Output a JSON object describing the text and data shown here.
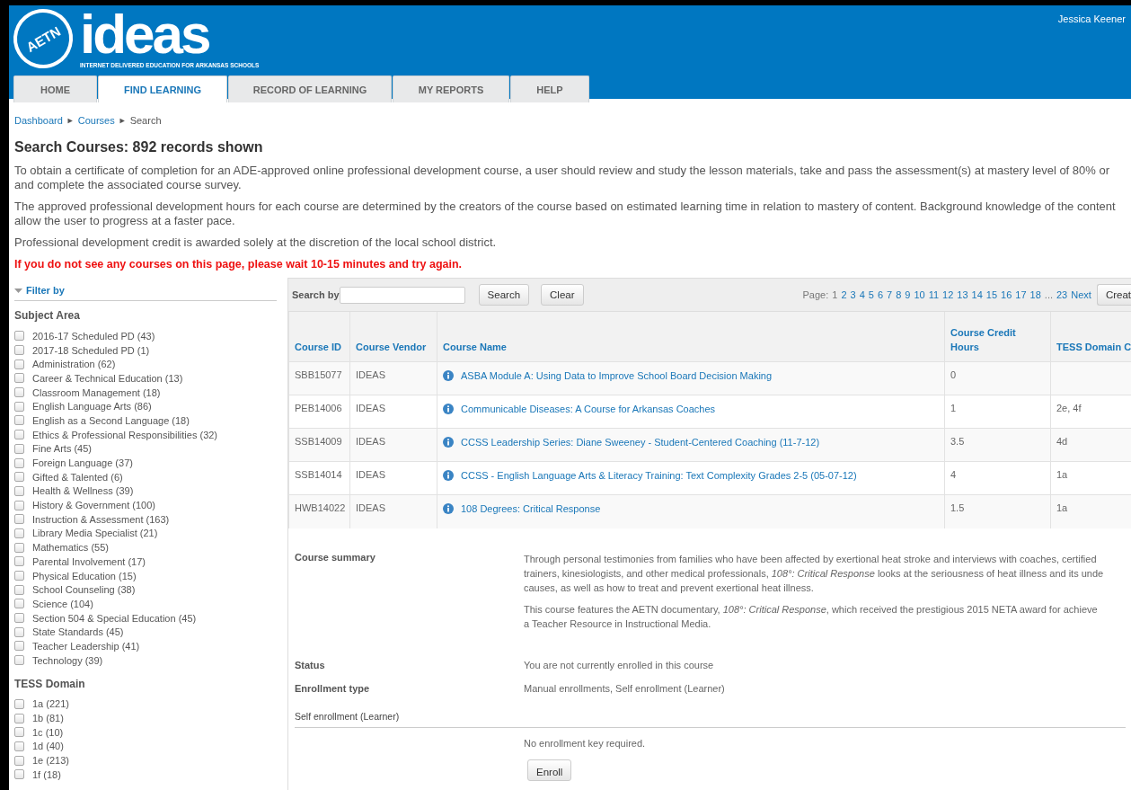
{
  "header": {
    "logo_badge": "AETN",
    "logo_word": "ideas",
    "tagline": "INTERNET DELIVERED EDUCATION FOR ARKANSAS SCHOOLS",
    "user": "Jessica Keener"
  },
  "tabs": [
    {
      "label": "HOME",
      "selected": false
    },
    {
      "label": "FIND LEARNING",
      "selected": true
    },
    {
      "label": "RECORD OF LEARNING",
      "selected": false
    },
    {
      "label": "MY REPORTS",
      "selected": false
    },
    {
      "label": "HELP",
      "selected": false
    }
  ],
  "breadcrumb": [
    {
      "label": "Dashboard",
      "kind": "link"
    },
    {
      "label": "►",
      "kind": "separator"
    },
    {
      "label": "Courses",
      "kind": "link"
    },
    {
      "label": "►",
      "kind": "separator"
    },
    {
      "label": "Search",
      "kind": "current"
    }
  ],
  "heading": "Search Courses: 892 records shown",
  "paragraphs": [
    "To obtain a certificate of completion for an ADE-approved online professional development course, a user should review and study the lesson materials, take and pass the assessment(s) at mastery level of 80% or\nand complete the associated course survey.",
    "The approved professional development hours for each course are determined by the creators of the course based on estimated learning time in relation to mastery of content. Background knowledge of the content\nallow the user to progress at a faster pace.",
    "Professional development credit is awarded solely at the discretion of the local school district."
  ],
  "warning": "If you do not see any courses on this page, please wait 10-15 minutes and try again.",
  "filter": {
    "title": "Filter by",
    "expanded": true,
    "groups": [
      {
        "title": "Subject Area",
        "items": [
          {
            "label": "2016-17 Scheduled PD (43)",
            "checked": false
          },
          {
            "label": "2017-18 Scheduled PD (1)",
            "checked": false
          },
          {
            "label": "Administration (62)",
            "checked": false
          },
          {
            "label": "Career & Technical Education (13)",
            "checked": false
          },
          {
            "label": "Classroom Management (18)",
            "checked": false
          },
          {
            "label": "English Language Arts (86)",
            "checked": false
          },
          {
            "label": "English as a Second Language (18)",
            "checked": false
          },
          {
            "label": "Ethics & Professional Responsibilities (32)",
            "checked": false
          },
          {
            "label": "Fine Arts (45)",
            "checked": false
          },
          {
            "label": "Foreign Language (37)",
            "checked": false
          },
          {
            "label": "Gifted & Talented (6)",
            "checked": false
          },
          {
            "label": "Health & Wellness (39)",
            "checked": false
          },
          {
            "label": "History & Government (100)",
            "checked": false
          },
          {
            "label": "Instruction & Assessment (163)",
            "checked": false
          },
          {
            "label": "Library Media Specialist (21)",
            "checked": false
          },
          {
            "label": "Mathematics (55)",
            "checked": false
          },
          {
            "label": "Parental Involvement (17)",
            "checked": false
          },
          {
            "label": "Physical Education (15)",
            "checked": false
          },
          {
            "label": "School Counseling (38)",
            "checked": false
          },
          {
            "label": "Science (104)",
            "checked": false
          },
          {
            "label": "Section 504 & Special Education (45)",
            "checked": false
          },
          {
            "label": "State Standards (45)",
            "checked": false
          },
          {
            "label": "Teacher Leadership (41)",
            "checked": false
          },
          {
            "label": "Technology (39)",
            "checked": false
          }
        ]
      },
      {
        "title": "TESS Domain",
        "items": [
          {
            "label": "1a (221)",
            "checked": false
          },
          {
            "label": "1b (81)",
            "checked": false
          },
          {
            "label": "1c (10)",
            "checked": false
          },
          {
            "label": "1d (40)",
            "checked": false
          },
          {
            "label": "1e (213)",
            "checked": false
          },
          {
            "label": "1f (18)",
            "checked": false
          }
        ]
      }
    ]
  },
  "search": {
    "label": "Search by",
    "buttons": [
      "Search",
      "Clear"
    ]
  },
  "pagination": {
    "label": "Page:",
    "pages": [
      {
        "label": "1",
        "selected": true
      },
      {
        "label": "2",
        "selected": false
      },
      {
        "label": "3",
        "selected": false
      },
      {
        "label": "4",
        "selected": false
      },
      {
        "label": "5",
        "selected": false
      },
      {
        "label": "6",
        "selected": false
      },
      {
        "label": "7",
        "selected": false
      },
      {
        "label": "8",
        "selected": false
      },
      {
        "label": "9",
        "selected": false
      },
      {
        "label": "10",
        "selected": false
      },
      {
        "label": "11",
        "selected": false
      },
      {
        "label": "12",
        "selected": false
      },
      {
        "label": "13",
        "selected": false
      },
      {
        "label": "14",
        "selected": false
      },
      {
        "label": "15",
        "selected": false
      },
      {
        "label": "16",
        "selected": false
      },
      {
        "label": "17",
        "selected": false
      },
      {
        "label": "18",
        "selected": false
      }
    ],
    "ellipsis": "...",
    "last": "23",
    "next": "Next"
  },
  "create_button": "Creat",
  "table": {
    "columns": [
      "Course ID",
      "Course Vendor",
      "Course Name",
      "Course Credit Hours",
      "TESS Domain C"
    ],
    "rows": [
      {
        "cells": [
          "SBB15077",
          "IDEAS",
          "ASBA Module A: Using Data to Improve School Board Decision Making",
          "0",
          ""
        ]
      },
      {
        "cells": [
          "PEB14006",
          "IDEAS",
          "Communicable Diseases: A Course for Arkansas Coaches",
          "1",
          "2e, 4f"
        ]
      },
      {
        "cells": [
          "SSB14009",
          "IDEAS",
          "CCSS Leadership Series: Diane Sweeney - Student-Centered Coaching (11-7-12)",
          "3.5",
          "4d"
        ]
      },
      {
        "cells": [
          "SSB14014",
          "IDEAS",
          "CCSS - English Language Arts & Literacy Training: Text Complexity Grades 2-5 (05-07-12)",
          "4",
          "1a"
        ]
      },
      {
        "cells": [
          "HWB14022",
          "IDEAS",
          "108 Degrees: Critical Response",
          "1.5",
          "1a"
        ]
      }
    ]
  },
  "details": {
    "summary_label": "Course summary",
    "summary": [
      "Through personal testimonies from families who have been affected by exertional heat stroke and interviews with coaches, certified\ntrainers, kinesiologists, and other medical professionals, *108°: Critical Response* looks at the seriousness of heat illness and its unde\ncauses, as well as how to treat and prevent exertional heat illness.",
      "This course features the AETN documentary, *108°: Critical Response*, which received the prestigious 2015 NETA award for achieve\na Teacher Resource in Instructional Media."
    ],
    "fields": [
      {
        "label": "Status",
        "value": "You are not currently enrolled in this course"
      },
      {
        "label": "Enrollment type",
        "value": "Manual enrollments, Self enrollment (Learner)"
      }
    ],
    "section": "Self enrollment (Learner)",
    "note": "No enrollment key required.",
    "button": "Enroll"
  }
}
